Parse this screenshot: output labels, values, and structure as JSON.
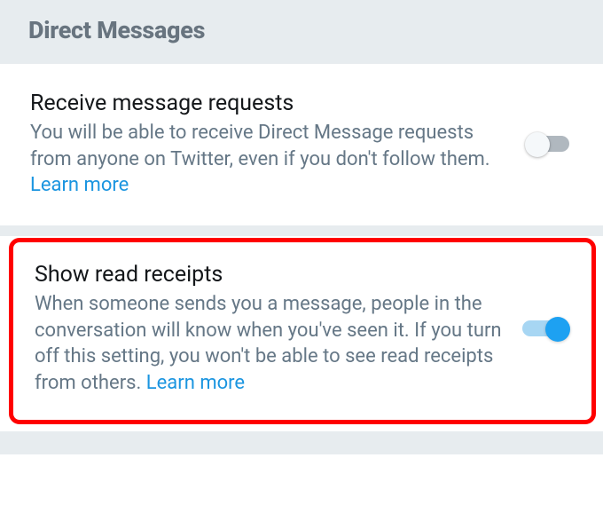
{
  "header": {
    "title": "Direct Messages"
  },
  "settings": {
    "receive_requests": {
      "title": "Receive message requests",
      "description": "You will be able to receive Direct Message requests from anyone on Twitter, even if you don't follow them. ",
      "learn_more": "Learn more",
      "enabled": false
    },
    "read_receipts": {
      "title": "Show read receipts",
      "description": "When someone sends you a message, people in the conversation will know when you've seen it. If you turn off this setting, you won't be able to see read receipts from others. ",
      "learn_more": "Learn more",
      "enabled": true,
      "highlighted": true
    }
  },
  "colors": {
    "accent": "#1da1f2",
    "header_bg": "#e7ecef",
    "text_muted": "#657786",
    "link": "#1b95e0",
    "highlight_border": "#ff0000"
  }
}
